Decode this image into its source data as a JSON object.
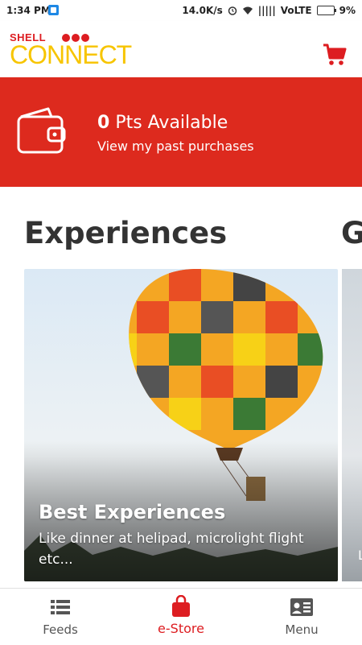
{
  "status_bar": {
    "time": "1:34 PM",
    "speed": "14.0K/s",
    "network": "VoLTE",
    "signal": "|||||",
    "battery": "9%"
  },
  "app": {
    "logo_top": "SHELL",
    "logo_main": "CONNECT",
    "cart_icon": "cart-icon"
  },
  "banner": {
    "points_value": "0",
    "points_label": "Pts Available",
    "past_purchases": "View my past purchases"
  },
  "sections": {
    "experiences_title": "Experiences",
    "next_title_partial": "G"
  },
  "card": {
    "title": "Best Experiences",
    "subtitle": "Like dinner at helipad, microlight flight etc...",
    "next_card_title_partial": "",
    "next_card_sub_partial": "L"
  },
  "bottom_nav": {
    "feeds": "Feeds",
    "estore": "e-Store",
    "menu": "Menu"
  },
  "colors": {
    "brand_red": "#dd2a1e",
    "brand_yellow": "#f7c500"
  }
}
